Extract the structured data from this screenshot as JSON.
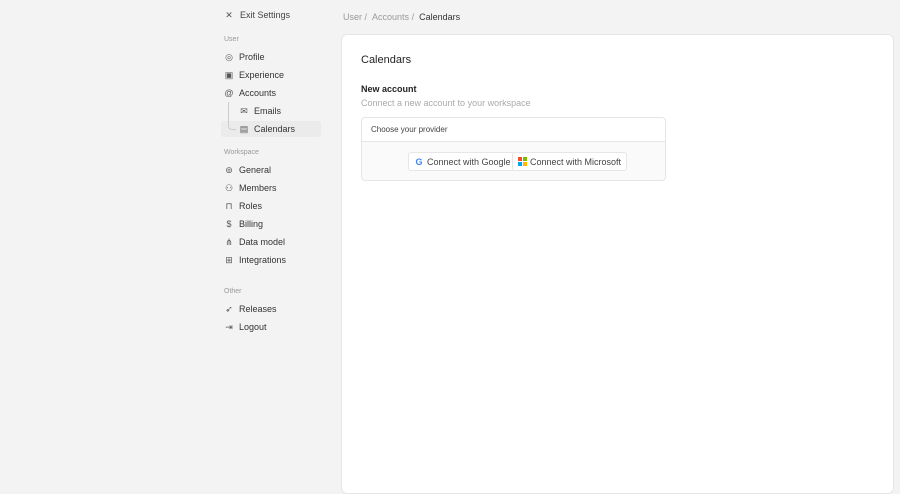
{
  "exit_label": "Exit Settings",
  "breadcrumb": [
    "User",
    "Accounts",
    "Calendars"
  ],
  "sidebar": {
    "user_header": "User",
    "workspace_header": "Workspace",
    "other_header": "Other",
    "user_items": [
      {
        "label": "Profile",
        "icon": "user-circle-icon"
      },
      {
        "label": "Experience",
        "icon": "experience-icon"
      },
      {
        "label": "Accounts",
        "icon": "at-icon"
      }
    ],
    "sub_items": [
      {
        "label": "Emails",
        "icon": "mail-icon"
      },
      {
        "label": "Calendars",
        "icon": "calendar-icon"
      }
    ],
    "workspace_items": [
      {
        "label": "General"
      },
      {
        "label": "Members"
      },
      {
        "label": "Roles"
      },
      {
        "label": "Billing"
      },
      {
        "label": "Data model"
      },
      {
        "label": "Integrations"
      }
    ],
    "other_items": [
      {
        "label": "Releases"
      },
      {
        "label": "Logout"
      }
    ]
  },
  "main": {
    "title": "Calendars",
    "section_title": "New account",
    "section_desc": "Connect a new account to your workspace",
    "provider_header": "Choose your provider",
    "google_label": "Connect with Google",
    "microsoft_label": "Connect with Microsoft"
  }
}
